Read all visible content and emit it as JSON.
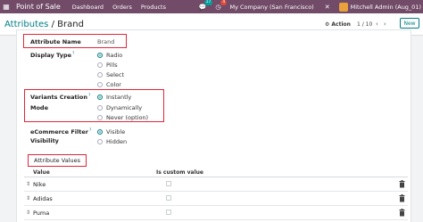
{
  "navbar": {
    "app_name": "Point of Sale",
    "menu": [
      "Dashboard",
      "Orders",
      "Products"
    ],
    "messages_count": "17",
    "activity_count": "4",
    "company": "My Company (San Francisco)",
    "user": "Mitchell Admin (Aug_01)",
    "brand_color": "#714b67"
  },
  "breadcrumb": {
    "parent": "Attributes",
    "separator": "/",
    "current": "Brand"
  },
  "control": {
    "action_label": "Action",
    "pager": "1 / 10",
    "new_label": "New"
  },
  "form": {
    "attribute_name_label": "Attribute Name",
    "attribute_name_value": "Brand",
    "display_type_label": "Display Type",
    "display_type_options": [
      "Radio",
      "Pills",
      "Select",
      "Color"
    ],
    "display_type_selected": "Radio",
    "variants_label_line1": "Variants Creation",
    "variants_label_line2": "Mode",
    "variants_options": [
      "Instantly",
      "Dynamically",
      "Never (option)"
    ],
    "variants_selected": "Instantly",
    "ecommerce_label_line1": "eCommerce Filter",
    "ecommerce_label_line2": "Visibility",
    "ecommerce_options": [
      "Visible",
      "Hidden"
    ],
    "ecommerce_selected": "Visible",
    "help_mark": "?"
  },
  "tabs": {
    "attribute_values": "Attribute Values"
  },
  "table": {
    "columns": [
      "Value",
      "Is custom value"
    ],
    "rows": [
      {
        "value": "Nike",
        "is_custom": false
      },
      {
        "value": "Adidas",
        "is_custom": false
      },
      {
        "value": "Puma",
        "is_custom": false
      }
    ]
  },
  "colors": {
    "accent": "#017e84",
    "highlight": "#e0263a"
  }
}
